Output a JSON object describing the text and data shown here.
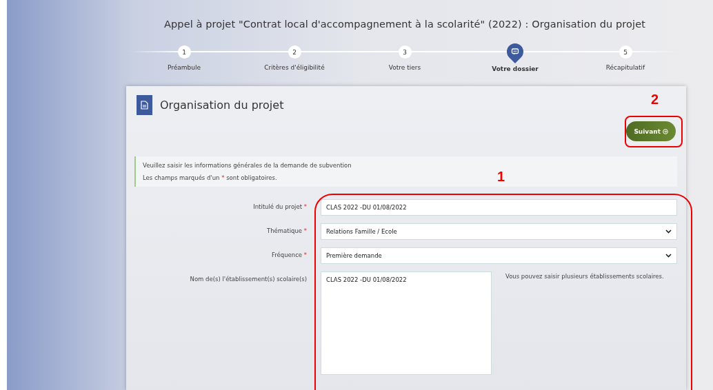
{
  "page_title": "Appel à projet \"Contrat local d'accompagnement à la scolarité\" (2022) : Organisation du projet",
  "steps": [
    {
      "number": "1",
      "label": "Préambule",
      "selected": false
    },
    {
      "number": "2",
      "label": "Critères d'éligibilité",
      "selected": false
    },
    {
      "number": "3",
      "label": "Votre tiers",
      "selected": false
    },
    {
      "label": "Votre dossier",
      "selected": true
    },
    {
      "number": "5",
      "label": "Récapitulatif",
      "selected": false
    }
  ],
  "card": {
    "title": "Organisation du projet",
    "next_button": "Suivant",
    "notice": {
      "line": "Veuillez saisir les informations générales de la demande de subvention",
      "required_before": "Les champs marqués d'un",
      "required_mark": "*",
      "required_after": "sont obligatoires."
    },
    "fields": [
      {
        "kind": "text",
        "label": "Intitulé du projet",
        "required": true,
        "value": "CLAS 2022 -DU 01/08/2022"
      },
      {
        "kind": "select",
        "label": "Thématique",
        "required": true,
        "value": "Relations Famille / Ecole"
      },
      {
        "kind": "select",
        "label": "Fréquence",
        "required": true,
        "value": "Première demande"
      },
      {
        "kind": "textarea",
        "label": "Nom de(s) l'établissement(s) scolaire(s)",
        "required": false,
        "value": "CLAS 2022 -DU 01/08/2022",
        "help": "Vous pouvez saisir plusieurs établissements scolaires."
      }
    ]
  },
  "annotations": [
    {
      "label": "1"
    },
    {
      "label": "2"
    }
  ]
}
